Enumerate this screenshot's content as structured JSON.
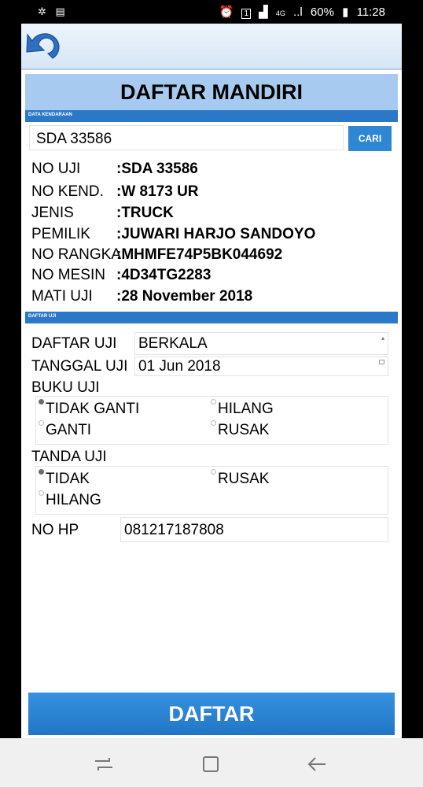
{
  "status_bar": {
    "time": "11:28",
    "battery": "60%",
    "network": "4G",
    "signal_bars": "..l",
    "alarm_icon": "alarm-clock-icon",
    "sim_badge": "1"
  },
  "header": {
    "title": "DAFTAR MANDIRI",
    "back_icon": "back-arrow-icon"
  },
  "vehicle_section": {
    "label": "DATA KENDARAAN",
    "search_value": "SDA 33586",
    "search_button": "CARI",
    "rows": [
      {
        "label": "NO UJI",
        "value": ":SDA 33586"
      },
      {
        "label": "NO KEND.",
        "value": ":W 8173 UR"
      },
      {
        "label": "JENIS",
        "value": ":TRUCK"
      },
      {
        "label": "PEMILIK",
        "value": ":JUWARI HARJO SANDOYO"
      },
      {
        "label": "NO RANGKA",
        "value": ":MHMFE74P5BK044692"
      },
      {
        "label": "NO MESIN",
        "value": ":4D34TG2283"
      },
      {
        "label": "MATI UJI",
        "value": ":28 November 2018"
      }
    ]
  },
  "test_section": {
    "label": "DAFTAR UJI",
    "daftar_uji_label": "DAFTAR UJI",
    "daftar_uji_value": "BERKALA",
    "tanggal_label": "TANGGAL UJI",
    "tanggal_value": "01 Jun 2018",
    "buku_uji_label": "BUKU UJI",
    "buku_uji_options": [
      {
        "label": "TIDAK GANTI",
        "checked": true
      },
      {
        "label": "HILANG",
        "checked": false
      },
      {
        "label": "GANTI",
        "checked": false
      },
      {
        "label": "RUSAK",
        "checked": false
      }
    ],
    "tanda_uji_label": "TANDA UJI",
    "tanda_uji_options": [
      {
        "label": "TIDAK",
        "checked": true
      },
      {
        "label": "RUSAK",
        "checked": false
      },
      {
        "label": "HILANG",
        "checked": false
      }
    ],
    "hp_label": "NO HP",
    "hp_value": "081217187808"
  },
  "submit_label": "DAFTAR",
  "colors": {
    "primary": "#2f87d4",
    "title_band": "#a7cbf0",
    "section_band": "#2a78c7"
  }
}
